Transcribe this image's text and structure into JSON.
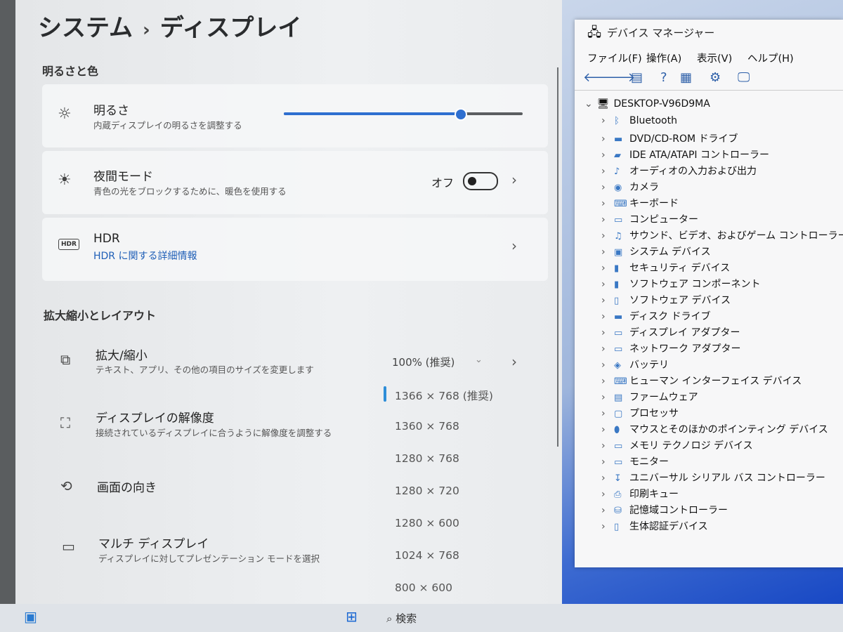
{
  "settings": {
    "breadcrumb_parent": "システム",
    "breadcrumb_sep": "›",
    "breadcrumb_current": "ディスプレイ",
    "section_brightness": "明るさと色",
    "brightness": {
      "title": "明るさ",
      "subtitle": "内蔵ディスプレイの明るさを調整する",
      "level": 0.74
    },
    "night_mode": {
      "title": "夜間モード",
      "subtitle": "青色の光をブロックするために、暖色を使用する",
      "state_label": "オフ"
    },
    "hdr": {
      "icon_text": "HDR",
      "title": "HDR",
      "link": "HDR に関する詳細情報"
    },
    "section_scale": "拡大縮小とレイアウト",
    "scale": {
      "title": "拡大/縮小",
      "subtitle": "テキスト、アプリ、その他の項目のサイズを変更します",
      "value": "100% (推奨)"
    },
    "resolution": {
      "title": "ディスプレイの解像度",
      "subtitle": "接続されているディスプレイに合うように解像度を調整する"
    },
    "orientation": {
      "title": "画面の向き"
    },
    "multi": {
      "title": "マルチ ディスプレイ",
      "subtitle": "ディスプレイに対してプレゼンテーション モードを選択"
    },
    "resolution_options": [
      "1366 × 768 (推奨)",
      "1360 × 768",
      "1280 × 768",
      "1280 × 720",
      "1280 × 600",
      "1024 × 768",
      "800 × 600"
    ]
  },
  "device_manager": {
    "title": "デバイス マネージャー",
    "menu": [
      "ファイル(F)",
      "操作(A)",
      "表示(V)",
      "ヘルプ(H)"
    ],
    "root": "DESKTOP-V96D9MA",
    "items": [
      {
        "label": "Bluetooth",
        "icon": "bluetooth-icon"
      },
      {
        "label": "DVD/CD-ROM ドライブ",
        "icon": "disc-drive-icon"
      },
      {
        "label": "IDE ATA/ATAPI コントローラー",
        "icon": "ide-controller-icon"
      },
      {
        "label": "オーディオの入力および出力",
        "icon": "audio-icon"
      },
      {
        "label": "カメラ",
        "icon": "camera-icon"
      },
      {
        "label": "キーボード",
        "icon": "keyboard-icon"
      },
      {
        "label": "コンピューター",
        "icon": "computer-icon"
      },
      {
        "label": "サウンド、ビデオ、およびゲーム コントローラー",
        "icon": "sound-icon"
      },
      {
        "label": "システム デバイス",
        "icon": "system-device-icon"
      },
      {
        "label": "セキュリティ デバイス",
        "icon": "security-device-icon"
      },
      {
        "label": "ソフトウェア コンポーネント",
        "icon": "software-component-icon"
      },
      {
        "label": "ソフトウェア デバイス",
        "icon": "software-device-icon"
      },
      {
        "label": "ディスク ドライブ",
        "icon": "disk-drive-icon"
      },
      {
        "label": "ディスプレイ アダプター",
        "icon": "display-adapter-icon"
      },
      {
        "label": "ネットワーク アダプター",
        "icon": "network-adapter-icon"
      },
      {
        "label": "バッテリ",
        "icon": "battery-icon"
      },
      {
        "label": "ヒューマン インターフェイス デバイス",
        "icon": "hid-icon"
      },
      {
        "label": "ファームウェア",
        "icon": "firmware-icon"
      },
      {
        "label": "プロセッサ",
        "icon": "processor-icon"
      },
      {
        "label": "マウスとそのほかのポインティング デバイス",
        "icon": "mouse-icon"
      },
      {
        "label": "メモリ テクノロジ デバイス",
        "icon": "memory-icon"
      },
      {
        "label": "モニター",
        "icon": "monitor-icon"
      },
      {
        "label": "ユニバーサル シリアル バス コントローラー",
        "icon": "usb-icon"
      },
      {
        "label": "印刷キュー",
        "icon": "printer-icon"
      },
      {
        "label": "記憶域コントローラー",
        "icon": "storage-controller-icon"
      },
      {
        "label": "生体認証デバイス",
        "icon": "biometric-icon"
      }
    ]
  },
  "taskbar": {
    "search_label": "検索"
  },
  "colors": {
    "accent": "#2e6fd0",
    "link": "#1f5fb7"
  }
}
